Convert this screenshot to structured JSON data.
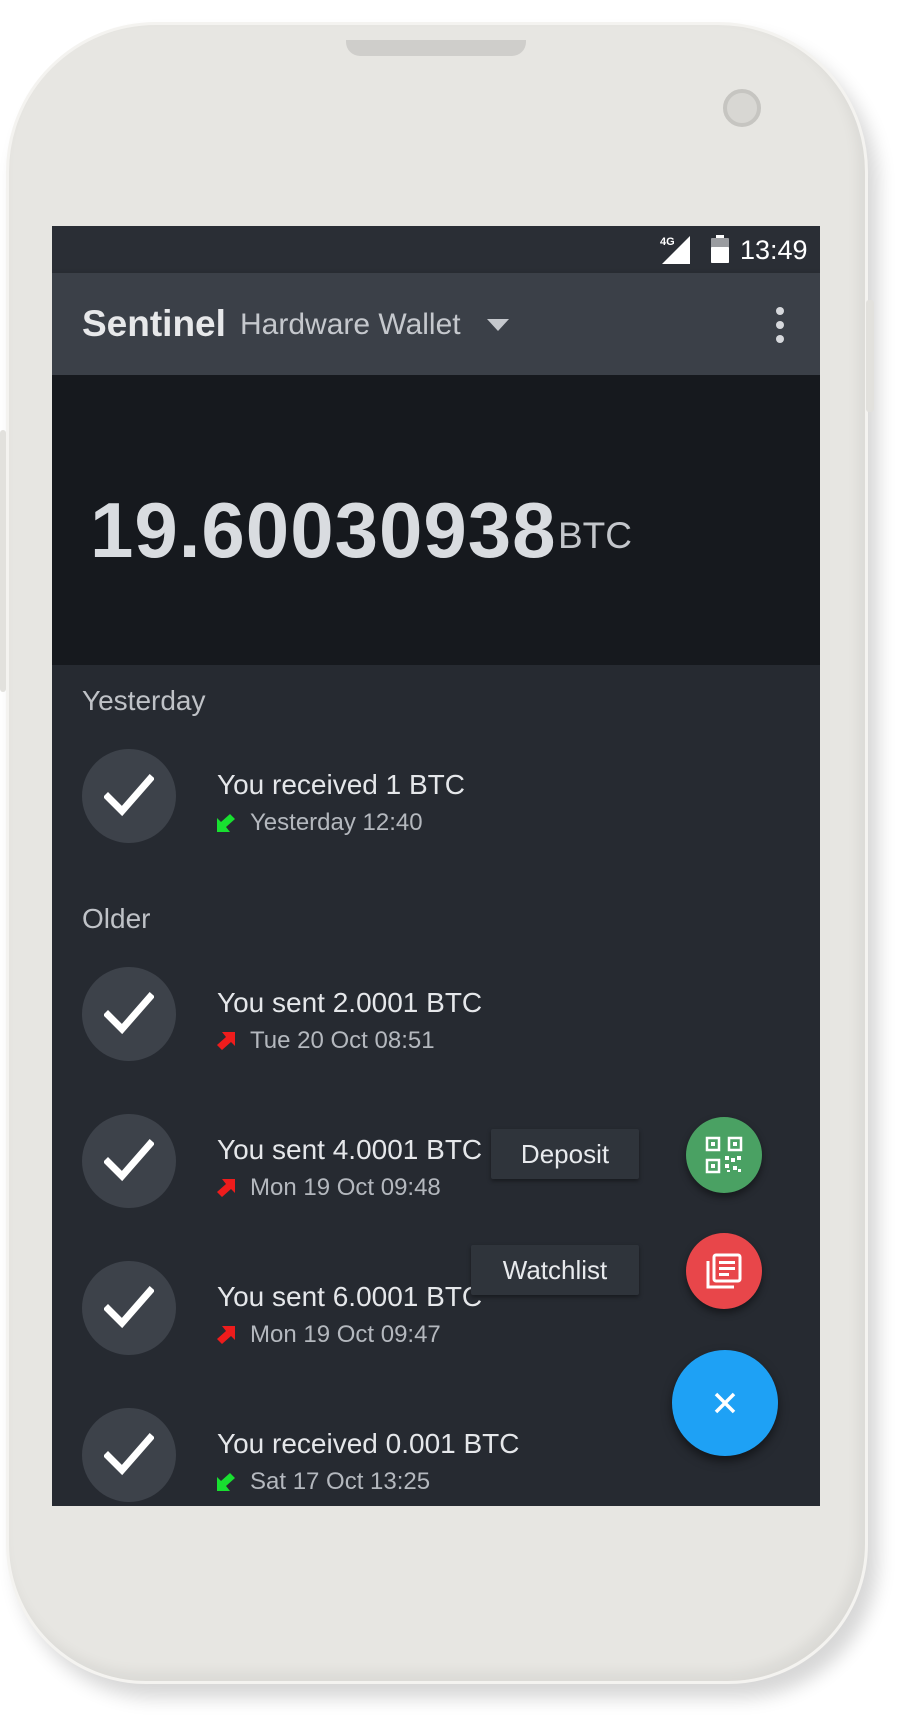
{
  "status_bar": {
    "network": "4G",
    "time": "13:49"
  },
  "toolbar": {
    "app_title": "Sentinel",
    "wallet_name": "Hardware Wallet"
  },
  "balance": {
    "amount": "19.60030938",
    "unit": "BTC"
  },
  "sections": [
    {
      "label": "Yesterday",
      "transactions": [
        {
          "title": "You received 1 BTC",
          "date": "Yesterday 12:40",
          "direction": "received"
        }
      ]
    },
    {
      "label": "Older",
      "transactions": [
        {
          "title": "You sent 2.0001 BTC",
          "date": "Tue 20 Oct 08:51",
          "direction": "sent"
        },
        {
          "title": "You sent 4.0001 BTC",
          "date": "Mon 19 Oct 09:48",
          "direction": "sent"
        },
        {
          "title": "You sent 6.0001 BTC",
          "date": "Mon 19 Oct 09:47",
          "direction": "sent"
        },
        {
          "title": "You received 0.001 BTC",
          "date": "Sat 17 Oct 13:25",
          "direction": "received"
        }
      ]
    }
  ],
  "fab_menu": {
    "deposit_label": "Deposit",
    "watchlist_label": "Watchlist"
  },
  "colors": {
    "received": "#18e030",
    "sent": "#ee1c1c",
    "fab_main": "#1ea1f5",
    "fab_deposit": "#4aa163",
    "fab_watchlist": "#e8464a"
  },
  "icons": {
    "check": "check-icon",
    "received": "arrow-down-left-icon",
    "sent": "arrow-up-right-icon",
    "deposit": "qr-code-icon",
    "watchlist": "list-icon",
    "close": "close-icon",
    "overflow": "more-vert-icon",
    "dropdown": "caret-down-icon"
  }
}
